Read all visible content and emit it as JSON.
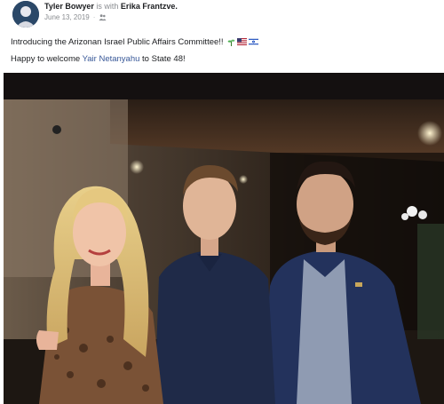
{
  "post": {
    "author": "Tyler Bowyer",
    "with_text": "is with",
    "tagged": "Erika Frantzve.",
    "date": "June 13, 2019",
    "audience_icon": "friends-icon",
    "lines": [
      {
        "text": "Introducing the Arizonan Israel Public Affairs Committee!!",
        "flags": [
          "plant-icon",
          "us-flag-icon",
          "israel-flag-icon"
        ]
      },
      {
        "prefix": "Happy to welcome ",
        "mention": "Yair Netanyahu",
        "suffix": " to State 48!"
      }
    ]
  },
  "colors": {
    "link": "#385898",
    "text": "#1c1e21",
    "meta": "#8a8d91"
  }
}
